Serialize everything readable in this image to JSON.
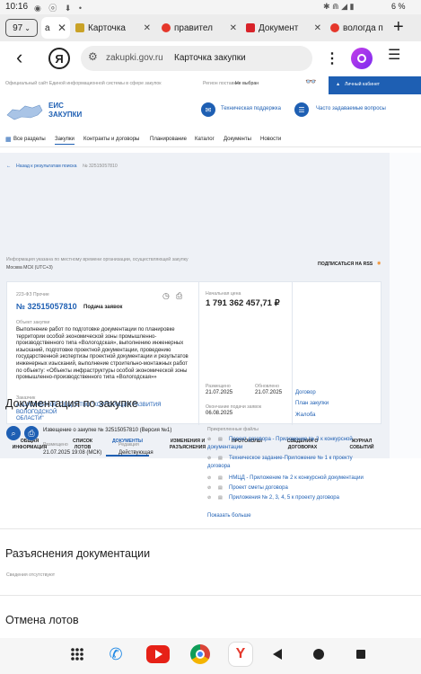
{
  "status": {
    "time": "10:16",
    "battery": "6 %"
  },
  "tabs": {
    "count": "97",
    "items": [
      {
        "label": "а"
      },
      {
        "label": "Карточка"
      },
      {
        "label": "правител"
      },
      {
        "label": "Документ"
      },
      {
        "label": "вологда п"
      }
    ]
  },
  "urlbar": {
    "domain": "zakupki.gov.ru",
    "title": "Карточка закупки"
  },
  "site": {
    "topline": "Официальный сайт Единой информационной системы в сфере закупок",
    "region_label": "Регион поставки:",
    "region_value": "Не выбран",
    "cabinet": "Личный кабинет",
    "logo_line1": "ЕИС",
    "logo_line2": "ЗАКУПКИ",
    "support": "Техническая поддержка",
    "faq": "Часто задаваемые вопросы",
    "nav": [
      "Все разделы",
      "Закупки",
      "Контракты и договоры",
      "Планирование",
      "Каталог",
      "Документы",
      "Новости"
    ]
  },
  "header": {
    "back": "Назад к результатам поиска",
    "back_id": "№ 32515057810",
    "tz_note": "Информация указана по местному времени организации, осуществляющей закупку",
    "tz_value": "Москва МСК (UTC+3)",
    "rss": "ПОДПИСАТЬСЯ НА RSS"
  },
  "purchase": {
    "law": "223-ФЗ Прочие",
    "number": "№ 32515057810",
    "stage": "Подача заявок",
    "object_label": "Объект закупки",
    "object_lines": [
      "Выполнение работ по подготовке документации по планировке",
      "территории особой экономической зоны промышленно-",
      "производственного типа «Вологодская», выполнению инженерных",
      "изысканий, подготовке проектной документации, проведению",
      "государственной экспертизы проектной документации и результатов",
      "инженерных изысканий, выполнение строительно-монтажных работ",
      "по объекту: «Объекты инфраструктуры особой экономической зоны",
      "промышленно-производственного типа «Вологодская»»"
    ],
    "customer_label": "Заказчик",
    "customer_lines": [
      "АКЦИОНЕРНОЕ ОБЩЕСТВО \"КОРПОРАЦИЯ РАЗВИТИЯ ВОЛОГОДСКОЙ",
      "ОБЛАСТИ\""
    ],
    "price_label": "Начальная цена",
    "price": "1 791 362 457,71 ₽",
    "posted_label": "Размещено",
    "posted": "21.07.2025",
    "updated_label": "Обновлено",
    "updated": "21.07.2025",
    "ends_label": "Окончание подачи заявок",
    "ends": "06.08.2025",
    "links": [
      "Договор",
      "План закупки",
      "Жалоба"
    ]
  },
  "card_tabs": [
    {
      "l1": "ОБЩАЯ",
      "l2": "ИНФОРМАЦИЯ"
    },
    {
      "l1": "СПИСОК",
      "l2": "ЛОТОВ"
    },
    {
      "l1": "ДОКУМЕНТЫ",
      "l2": ""
    },
    {
      "l1": "ИЗМЕНЕНИЯ И",
      "l2": "РАЗЪЯСНЕНИЯ"
    },
    {
      "l1": "ПРОТОКОЛЫ",
      "l2": ""
    },
    {
      "l1": "СВЕДЕНИЯ О",
      "l2": "ДОГОВОРАХ"
    },
    {
      "l1": "ЖУРНАЛ",
      "l2": "СОБЫТИЙ"
    }
  ],
  "docs": {
    "heading": "Документация по закупке",
    "notice": "Извещение о закупке № 32515057810 (Версия №1)",
    "placed_label": "Размещено",
    "placed_value": "21.07.2025 19:08 (МСК)",
    "edition_label": "Редакция",
    "edition_value": "Действующая",
    "attached_label": "Прикрепленные файлы",
    "files": [
      {
        "l1": "Проект договора - Приложение № 3 к конкурсной",
        "l2": "документации"
      },
      {
        "l1": "Техническое задание-Приложение № 1 к проекту",
        "l2": "договора"
      },
      {
        "l1": "НМЦД - Приложение № 2 к конкурсной документации",
        "l2": ""
      },
      {
        "l1": "Проект сметы договора",
        "l2": ""
      },
      {
        "l1": "Приложения № 2, 3, 4, 5 к проекту договора",
        "l2": ""
      }
    ],
    "show_more": "Показать больше"
  },
  "clarif": {
    "heading": "Разъяснения документации",
    "empty": "Сведения отсутствуют"
  },
  "cancel": {
    "heading": "Отмена лотов"
  },
  "colors": {
    "accent": "#1e5fb3",
    "panel": "#eef1f6",
    "logo_bg": "#9a1bd3"
  }
}
